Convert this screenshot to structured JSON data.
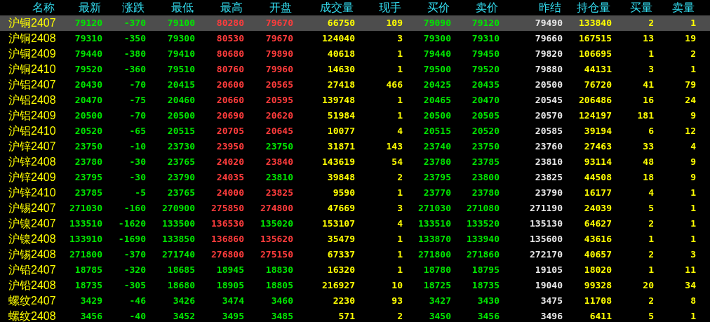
{
  "columns": [
    {
      "label": "名称",
      "kind": "name"
    },
    {
      "label": "最新",
      "kind": "price"
    },
    {
      "label": "涨跌",
      "kind": "change"
    },
    {
      "label": "最低",
      "kind": "price"
    },
    {
      "label": "最高",
      "kind": "price"
    },
    {
      "label": "开盘",
      "kind": "price"
    },
    {
      "label": "成交量",
      "kind": "volume"
    },
    {
      "label": "现手",
      "kind": "volume"
    },
    {
      "label": "买价",
      "kind": "price"
    },
    {
      "label": "卖价",
      "kind": "price"
    },
    {
      "label": "昨结",
      "kind": "settle"
    },
    {
      "label": "持仓量",
      "kind": "volume"
    },
    {
      "label": "买量",
      "kind": "volume"
    },
    {
      "label": "卖量",
      "kind": "volume"
    }
  ],
  "rows": [
    {
      "selected": true,
      "cells": [
        "沪铜2407",
        "79120",
        "-370",
        "79100",
        "80280",
        "79670",
        "66750",
        "109",
        "79090",
        "79120",
        "79490",
        "133840",
        "2",
        "1"
      ]
    },
    {
      "selected": false,
      "cells": [
        "沪铜2408",
        "79310",
        "-350",
        "79300",
        "80530",
        "79670",
        "124040",
        "3",
        "79300",
        "79310",
        "79660",
        "167515",
        "13",
        "19"
      ]
    },
    {
      "selected": false,
      "cells": [
        "沪铜2409",
        "79440",
        "-380",
        "79410",
        "80680",
        "79890",
        "40618",
        "1",
        "79440",
        "79450",
        "79820",
        "106695",
        "1",
        "2"
      ]
    },
    {
      "selected": false,
      "cells": [
        "沪铜2410",
        "79520",
        "-360",
        "79510",
        "80760",
        "79960",
        "14630",
        "1",
        "79500",
        "79520",
        "79880",
        "44131",
        "3",
        "1"
      ]
    },
    {
      "selected": false,
      "cells": [
        "沪铝2407",
        "20430",
        "-70",
        "20415",
        "20600",
        "20565",
        "27418",
        "466",
        "20425",
        "20435",
        "20500",
        "76720",
        "41",
        "79"
      ]
    },
    {
      "selected": false,
      "cells": [
        "沪铝2408",
        "20470",
        "-75",
        "20460",
        "20660",
        "20595",
        "139748",
        "1",
        "20465",
        "20470",
        "20545",
        "206486",
        "16",
        "24"
      ]
    },
    {
      "selected": false,
      "cells": [
        "沪铝2409",
        "20500",
        "-70",
        "20500",
        "20690",
        "20620",
        "51984",
        "1",
        "20500",
        "20505",
        "20570",
        "124197",
        "181",
        "9"
      ]
    },
    {
      "selected": false,
      "cells": [
        "沪铝2410",
        "20520",
        "-65",
        "20515",
        "20705",
        "20645",
        "10077",
        "4",
        "20515",
        "20520",
        "20585",
        "39194",
        "6",
        "12"
      ]
    },
    {
      "selected": false,
      "cells": [
        "沪锌2407",
        "23750",
        "-10",
        "23730",
        "23950",
        "23750",
        "31871",
        "143",
        "23740",
        "23750",
        "23760",
        "27463",
        "33",
        "4"
      ]
    },
    {
      "selected": false,
      "cells": [
        "沪锌2408",
        "23780",
        "-30",
        "23765",
        "24020",
        "23840",
        "143619",
        "54",
        "23780",
        "23785",
        "23810",
        "93114",
        "48",
        "9"
      ]
    },
    {
      "selected": false,
      "cells": [
        "沪锌2409",
        "23795",
        "-30",
        "23790",
        "24035",
        "23810",
        "39848",
        "2",
        "23795",
        "23800",
        "23825",
        "44508",
        "18",
        "9"
      ]
    },
    {
      "selected": false,
      "cells": [
        "沪锌2410",
        "23785",
        "-5",
        "23765",
        "24000",
        "23825",
        "9590",
        "1",
        "23770",
        "23780",
        "23790",
        "16177",
        "4",
        "1"
      ]
    },
    {
      "selected": false,
      "cells": [
        "沪锡2407",
        "271030",
        "-160",
        "270900",
        "275850",
        "274800",
        "47669",
        "3",
        "271030",
        "271080",
        "271190",
        "24039",
        "5",
        "1"
      ]
    },
    {
      "selected": false,
      "cells": [
        "沪镍2407",
        "133510",
        "-1620",
        "133500",
        "136530",
        "135020",
        "153107",
        "4",
        "133510",
        "133520",
        "135130",
        "64627",
        "2",
        "1"
      ]
    },
    {
      "selected": false,
      "cells": [
        "沪镍2408",
        "133910",
        "-1690",
        "133850",
        "136860",
        "135620",
        "35479",
        "1",
        "133870",
        "133940",
        "135600",
        "43616",
        "1",
        "1"
      ]
    },
    {
      "selected": false,
      "cells": [
        "沪锡2408",
        "271800",
        "-370",
        "271740",
        "276800",
        "275150",
        "67337",
        "1",
        "271800",
        "271860",
        "272170",
        "40657",
        "2",
        "3"
      ]
    },
    {
      "selected": false,
      "cells": [
        "沪铅2407",
        "18785",
        "-320",
        "18685",
        "18945",
        "18830",
        "16320",
        "1",
        "18780",
        "18795",
        "19105",
        "18020",
        "1",
        "11"
      ]
    },
    {
      "selected": false,
      "cells": [
        "沪铅2408",
        "18735",
        "-305",
        "18680",
        "18905",
        "18805",
        "216927",
        "10",
        "18725",
        "18735",
        "19040",
        "99328",
        "20",
        "34"
      ]
    },
    {
      "selected": false,
      "cells": [
        "螺纹2407",
        "3429",
        "-46",
        "3426",
        "3474",
        "3460",
        "2230",
        "93",
        "3427",
        "3430",
        "3475",
        "11708",
        "2",
        "8"
      ]
    },
    {
      "selected": false,
      "cells": [
        "螺纹2408",
        "3456",
        "-40",
        "3452",
        "3495",
        "3485",
        "571",
        "2",
        "3450",
        "3456",
        "3496",
        "6411",
        "5",
        "1"
      ]
    }
  ]
}
